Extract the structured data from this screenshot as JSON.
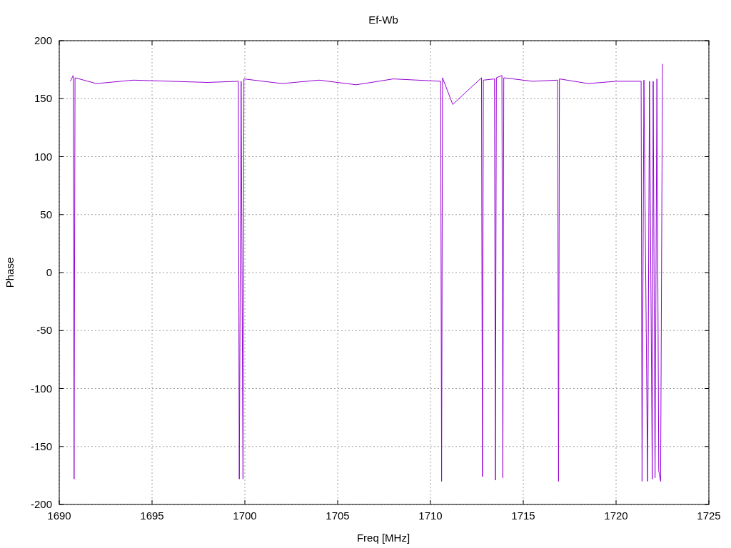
{
  "chart_data": {
    "type": "line",
    "title": "Ef-Wb",
    "xlabel": "Freq [MHz]",
    "ylabel": "Phase",
    "xlim": [
      1690,
      1725
    ],
    "ylim": [
      -200,
      200
    ],
    "grid": true,
    "xticks": [
      1690,
      1695,
      1700,
      1705,
      1710,
      1715,
      1720,
      1725
    ],
    "yticks": [
      -200,
      -150,
      -100,
      -50,
      0,
      50,
      100,
      150,
      200
    ],
    "x": [
      1690.6,
      1690.75,
      1690.8,
      1690.85,
      1692,
      1694,
      1696,
      1698,
      1699.65,
      1699.7,
      1699.8,
      1699.9,
      1699.95,
      1702,
      1704,
      1706,
      1708,
      1710.55,
      1710.6,
      1710.65,
      1711.2,
      1712.75,
      1712.8,
      1712.85,
      1713.45,
      1713.5,
      1713.55,
      1713.85,
      1713.9,
      1713.95,
      1715.5,
      1716.85,
      1716.9,
      1716.95,
      1718.5,
      1720,
      1721.35,
      1721.4,
      1721.5,
      1721.7,
      1721.8,
      1721.95,
      1722.0,
      1722.1,
      1722.2,
      1722.3,
      1722.4,
      1722.5
    ],
    "series": [
      {
        "color": "#9400d3",
        "values": [
          165,
          170,
          -178,
          168,
          163,
          166,
          165,
          164,
          165,
          -178,
          165,
          -178,
          167,
          163,
          166,
          162,
          167,
          165,
          -180,
          168,
          145,
          168,
          -176,
          166,
          167,
          -179,
          168,
          170,
          -177,
          168,
          165,
          166,
          -180,
          167,
          163,
          165,
          165,
          -180,
          166,
          -180,
          165,
          -178,
          165,
          -177,
          167,
          -171,
          -180,
          180
        ]
      }
    ]
  }
}
